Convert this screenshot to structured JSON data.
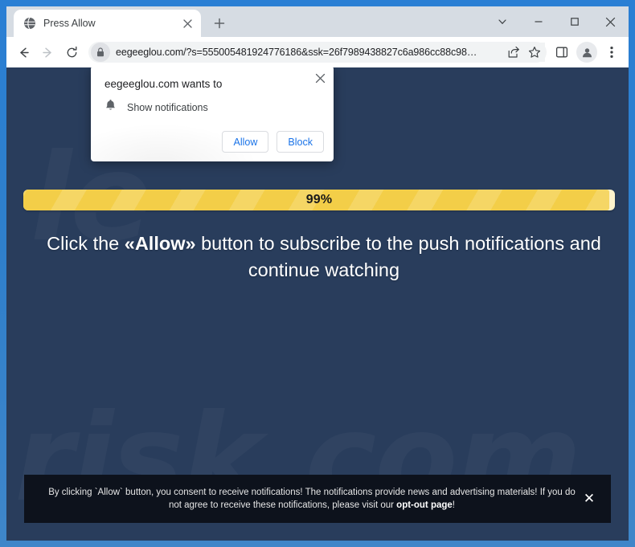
{
  "browser": {
    "tab": {
      "title": "Press Allow",
      "favicon": "globe-icon",
      "close_label": "×"
    },
    "new_tab_label": "+",
    "window_controls": {
      "tab_search": "tab-search-chevron",
      "minimize": "minimize",
      "maximize": "maximize",
      "close": "close"
    },
    "toolbar": {
      "back": "back-arrow",
      "forward": "forward-arrow",
      "reload": "reload-arrow",
      "url": "eegeeglou.com/?s=555005481924776186&ssk=26f7989438827c6a986cc88c98…",
      "lock": "lock-icon",
      "share": "share-icon",
      "bookmark": "star-icon",
      "side_panel": "side-panel-icon",
      "profile": "avatar-icon",
      "menu": "three-dot-menu-icon"
    }
  },
  "permission_dialog": {
    "title": "eegeeglou.com wants to",
    "permission_label": "Show notifications",
    "permission_icon": "bell-icon",
    "allow_label": "Allow",
    "block_label": "Block",
    "close_label": "×"
  },
  "page": {
    "background_color": "#293d5c",
    "watermark_lines": [
      "le",
      "\u0002",
      "risk.com"
    ],
    "progress": {
      "percent_label": "99%",
      "percent_value": 99,
      "fill_color": "#f3ce48",
      "track_color": "#fdf3cc"
    },
    "headline": {
      "before": "Click the ",
      "emphasis": "«Allow»",
      "after": " button to subscribe to the push notifications and continue watching"
    },
    "consent_banner": {
      "text_before": "By clicking `Allow` button, you consent to receive notifications! The notifications provide news and advertising materials! If you do not agree to receive these notifications, please visit our ",
      "link_label": "opt-out page",
      "text_after": "!",
      "close_label": "✕",
      "background_color": "#0d121c"
    }
  }
}
